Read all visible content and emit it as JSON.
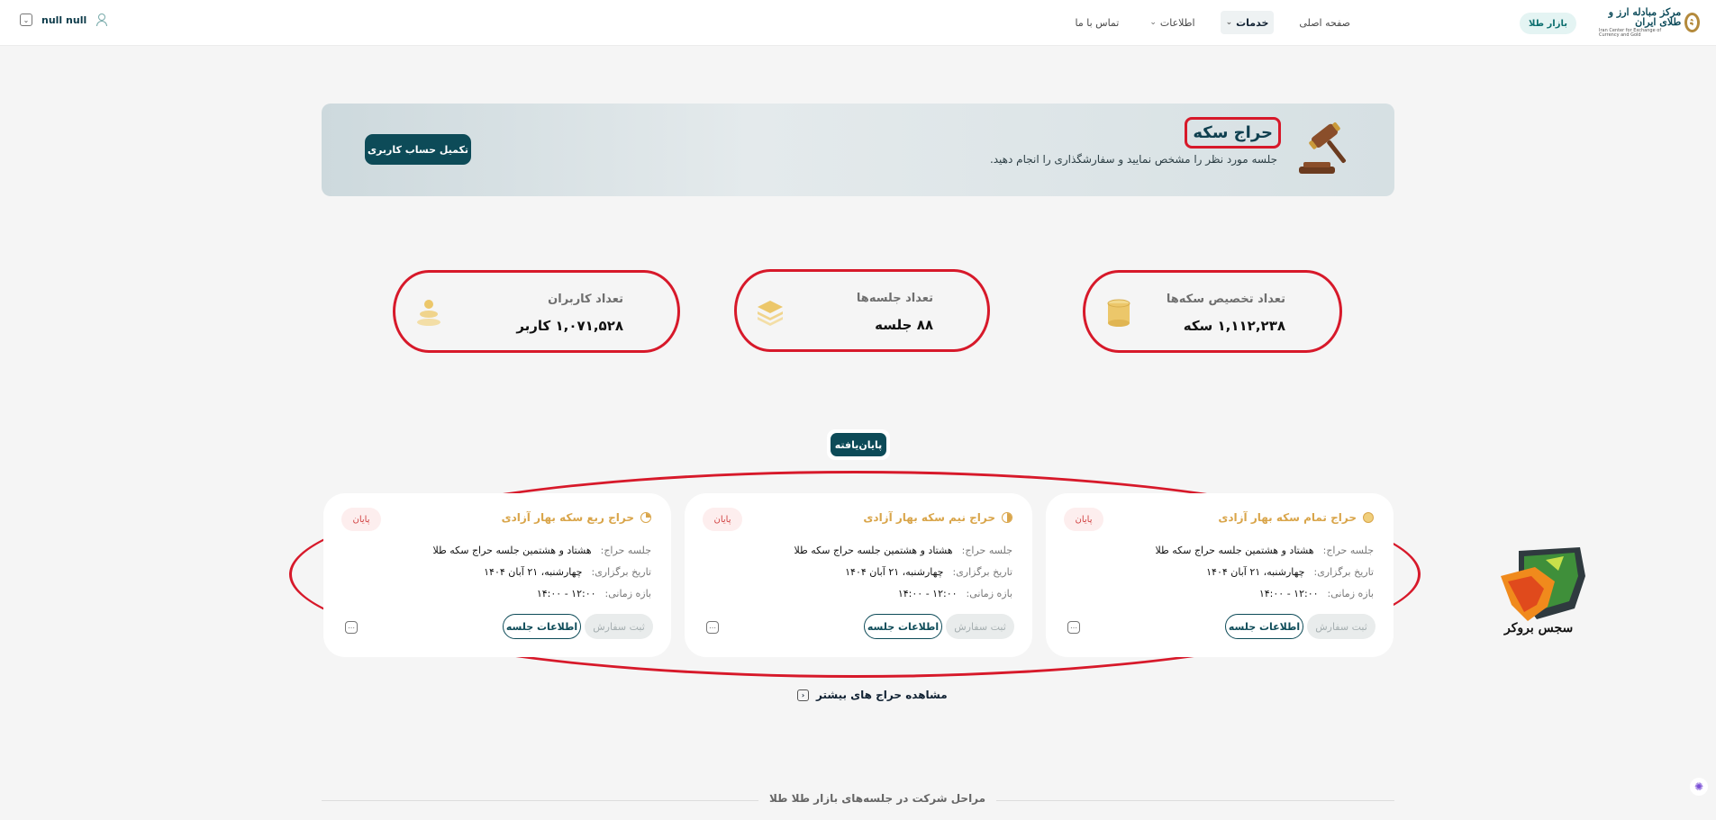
{
  "header": {
    "logo_fa": "مرکز مبادله ارز و طلای ایران",
    "logo_en": "Iran Center for Exchange of Currency and Gold",
    "gold_market_tag": "بازار طلا",
    "nav": [
      {
        "label": "صفحه اصلی",
        "has_chevron": false
      },
      {
        "label": "خدمات",
        "has_chevron": true
      },
      {
        "label": "اطلاعات",
        "has_chevron": true
      },
      {
        "label": "تماس با ما",
        "has_chevron": false
      }
    ],
    "user_name": "null null"
  },
  "banner": {
    "title": "حراج سکه",
    "subtitle": "جلسه مورد نظر را مشخص نمایید و سفارشگذاری را انجام دهید.",
    "button": "تکمیل حساب کاربری"
  },
  "stats": [
    {
      "label": "تعداد تخصیص سکه‌ها",
      "value": "۱,۱۱۲,۲۳۸ سکه",
      "icon": "coins-stack-icon"
    },
    {
      "label": "تعداد جلسه‌ها",
      "value": "۸۸ جلسه",
      "icon": "layers-icon"
    },
    {
      "label": "تعداد کاربران",
      "value": "۱,۰۷۱,۵۲۸ کاربر",
      "icon": "users-icon"
    }
  ],
  "filter": {
    "active": "پایان‌یافته"
  },
  "auctions": [
    {
      "title": "حراج تمام سکه بهار آزادی",
      "coin": "full",
      "status": "پایان",
      "session_key": "جلسه حراج:",
      "session_value": "هشتاد و هشتمین جلسه حراج سکه طلا",
      "date_key": "تاریخ برگزاری:",
      "date_value": "چهارشنبه، ۲۱ آبان ۱۴۰۴",
      "time_key": "بازه زمانی:",
      "time_value": "۱۲:۰۰ - ۱۴:۰۰",
      "order_btn": "ثبت سفارش",
      "info_btn": "اطلاعات جلسه"
    },
    {
      "title": "حراج نیم سکه بهار آزادی",
      "coin": "half",
      "status": "پایان",
      "session_key": "جلسه حراج:",
      "session_value": "هشتاد و هشتمین جلسه حراج سکه طلا",
      "date_key": "تاریخ برگزاری:",
      "date_value": "چهارشنبه، ۲۱ آبان ۱۴۰۴",
      "time_key": "بازه زمانی:",
      "time_value": "۱۲:۰۰ - ۱۴:۰۰",
      "order_btn": "ثبت سفارش",
      "info_btn": "اطلاعات جلسه"
    },
    {
      "title": "حراج ربع سکه بهار آزادی",
      "coin": "quarter",
      "status": "پایان",
      "session_key": "جلسه حراج:",
      "session_value": "هشتاد و هشتمین جلسه حراج سکه طلا",
      "date_key": "تاریخ برگزاری:",
      "date_value": "چهارشنبه، ۲۱ آبان ۱۴۰۴",
      "time_key": "بازه زمانی:",
      "time_value": "۱۲:۰۰ - ۱۴:۰۰",
      "order_btn": "ثبت سفارش",
      "info_btn": "اطلاعات جلسه"
    }
  ],
  "more_link": "مشاهده حراج های بیشتر",
  "broker_name": "سجس بروکر",
  "steps_title": "مراحل شرکت در جلسه‌های بازار طلا طلا",
  "colors": {
    "primary": "#0d4b58",
    "accent_gold": "#d9a54a",
    "highlight_red": "#d7192a",
    "badge_red": "#d24545"
  }
}
